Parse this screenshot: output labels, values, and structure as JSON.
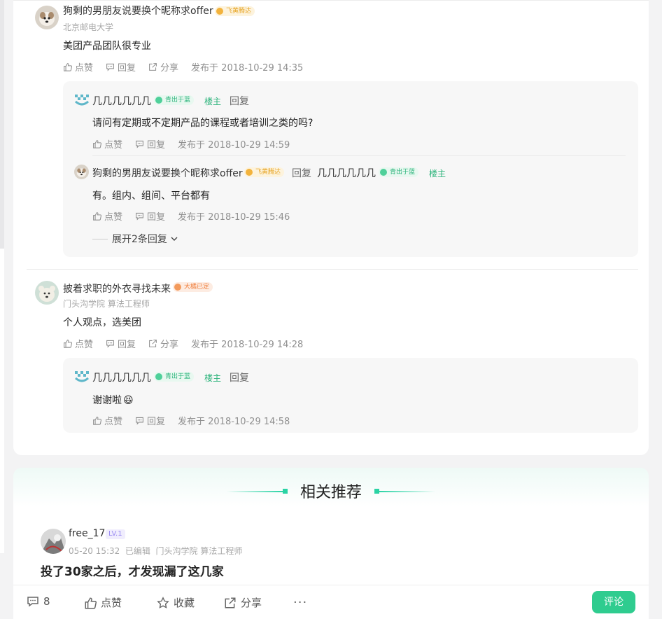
{
  "comments": [
    {
      "username": "狗剩的男朋友说要换个昵称求offer",
      "badge": "飞黄腾达",
      "school": "北京邮电大学",
      "text": "美团产品团队很专业",
      "actions": {
        "like": "点赞",
        "reply": "回复",
        "share": "分享"
      },
      "time": "发布于 2018-10-29 14:35",
      "replies": [
        {
          "username": "几几几几几几",
          "badge": "青出于蓝",
          "op_tag": "楼主",
          "reply_label": "回复",
          "text": "请问有定期或不定期产品的课程或者培训之类的吗?",
          "actions": {
            "like": "点赞",
            "reply": "回复"
          },
          "time": "发布于 2018-10-29 14:59"
        },
        {
          "username": "狗剩的男朋友说要换个昵称求offer",
          "badge": "飞黄腾达",
          "reply_label": "回复",
          "target_username": "几几几几几几",
          "target_badge": "青出于蓝",
          "target_op_tag": "楼主",
          "text": "有。组内、组间、平台都有",
          "actions": {
            "like": "点赞",
            "reply": "回复"
          },
          "time": "发布于 2018-10-29 15:46"
        }
      ],
      "expand_label": "展开2条回复"
    },
    {
      "username": "披着求职的外衣寻找未来",
      "badge": "大橘已定",
      "school": "门头沟学院 算法工程师",
      "text": "个人观点，选美团",
      "actions": {
        "like": "点赞",
        "reply": "回复",
        "share": "分享"
      },
      "time": "发布于 2018-10-29 14:28",
      "replies": [
        {
          "username": "几几几几几几",
          "badge": "青出于蓝",
          "op_tag": "楼主",
          "reply_label": "回复",
          "text": "谢谢啦",
          "emoji": "😆",
          "actions": {
            "like": "点赞",
            "reply": "回复"
          },
          "time": "发布于 2018-10-29 14:58"
        }
      ]
    }
  ],
  "recommend": {
    "title": "相关推荐",
    "post": {
      "username": "free_17",
      "level": "LV.1",
      "meta": "05-20 15:32  已编辑  门头沟学院 算法工程师",
      "title": "投了30家之后，才发现漏了这几家"
    }
  },
  "bottom_bar": {
    "comment_count": "8",
    "like": "点赞",
    "collect": "收藏",
    "share": "分享",
    "more": "···",
    "comment_button": "评论"
  },
  "colors": {
    "accent": "#2fcc8f",
    "op_green": "#2ab37a"
  }
}
